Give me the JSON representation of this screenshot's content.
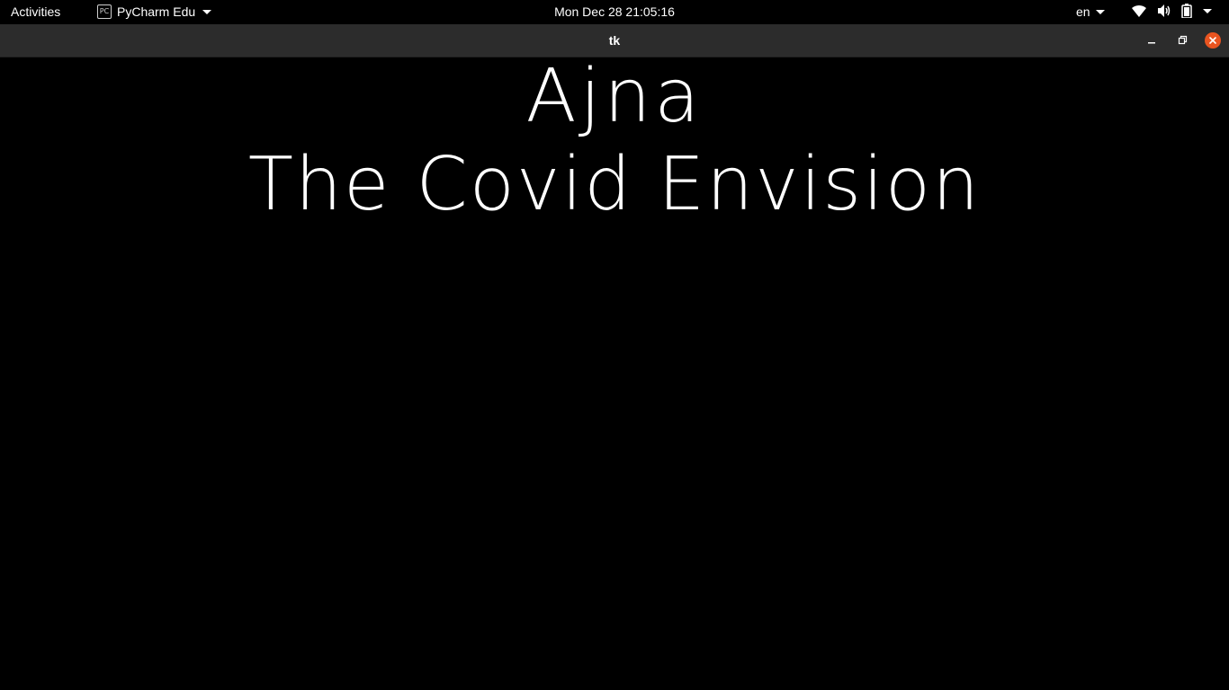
{
  "topbar": {
    "activities": "Activities",
    "app_name": "PyCharm Edu",
    "clock": "Mon Dec 28  21:05:16",
    "language": "en",
    "icons": [
      "wifi-icon",
      "volume-icon",
      "battery-icon",
      "system-menu-icon"
    ]
  },
  "window": {
    "title": "tk",
    "close_color": "#e95420"
  },
  "content": {
    "line1": "Ajna",
    "line2": "The Covid Envision",
    "background": "#000000",
    "text_color": "#ffffff"
  }
}
